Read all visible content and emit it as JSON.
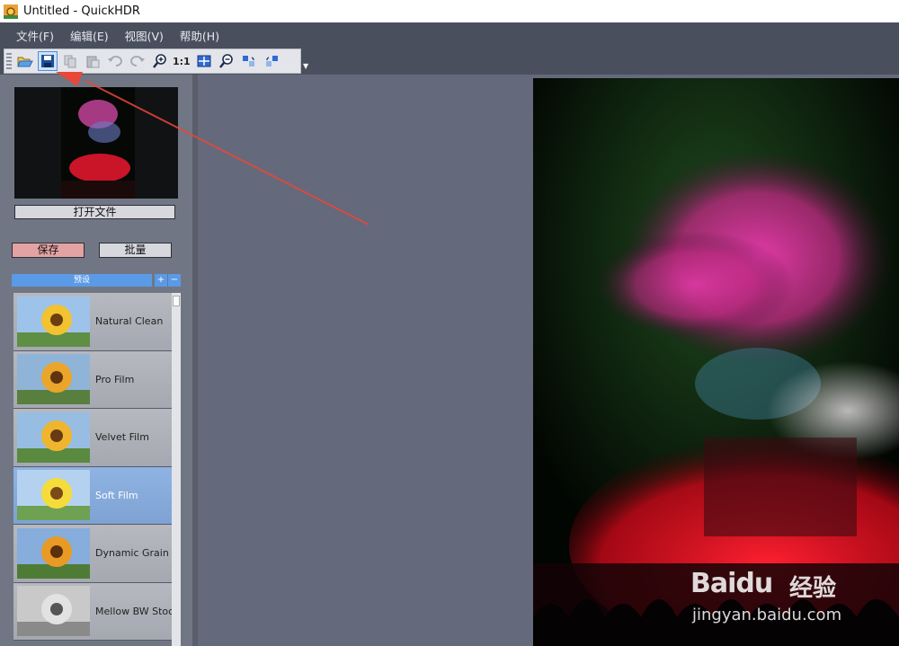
{
  "window": {
    "title": "Untitled - QuickHDR"
  },
  "menu": {
    "items": [
      "文件(F)",
      "编辑(E)",
      "视图(V)",
      "帮助(H)"
    ]
  },
  "toolbar": {
    "buttons": [
      "open-icon",
      "save-icon",
      "copy-icon",
      "paste-icon",
      "undo-icon",
      "redo-icon",
      "zoom-in-icon",
      "actual-size",
      "fit-window-icon",
      "zoom-out-icon",
      "rotate-left-icon",
      "rotate-right-icon"
    ],
    "actual_size_label": "1:1",
    "active_button": "save-icon"
  },
  "left_panel": {
    "open_file_label": "打开文件",
    "save_label": "保存",
    "batch_label": "批量",
    "presets_header": "预设",
    "add_label": "+",
    "remove_label": "−",
    "presets": [
      {
        "label": "Natural Clean",
        "selected": false
      },
      {
        "label": "Pro Film",
        "selected": false
      },
      {
        "label": "Velvet Film",
        "selected": false
      },
      {
        "label": "Soft Film",
        "selected": true
      },
      {
        "label": "Dynamic Grain",
        "selected": false
      },
      {
        "label": "Mellow BW Stoc",
        "selected": false
      }
    ]
  },
  "watermark": {
    "brand": "Baidu",
    "brand_cn": "经验",
    "url": "jingyan.baidu.com"
  },
  "colors": {
    "accent": "#5a9ae6",
    "save_button": "#e3a3a3",
    "canvas": "#646a7b",
    "arrow": "#e8473a"
  }
}
